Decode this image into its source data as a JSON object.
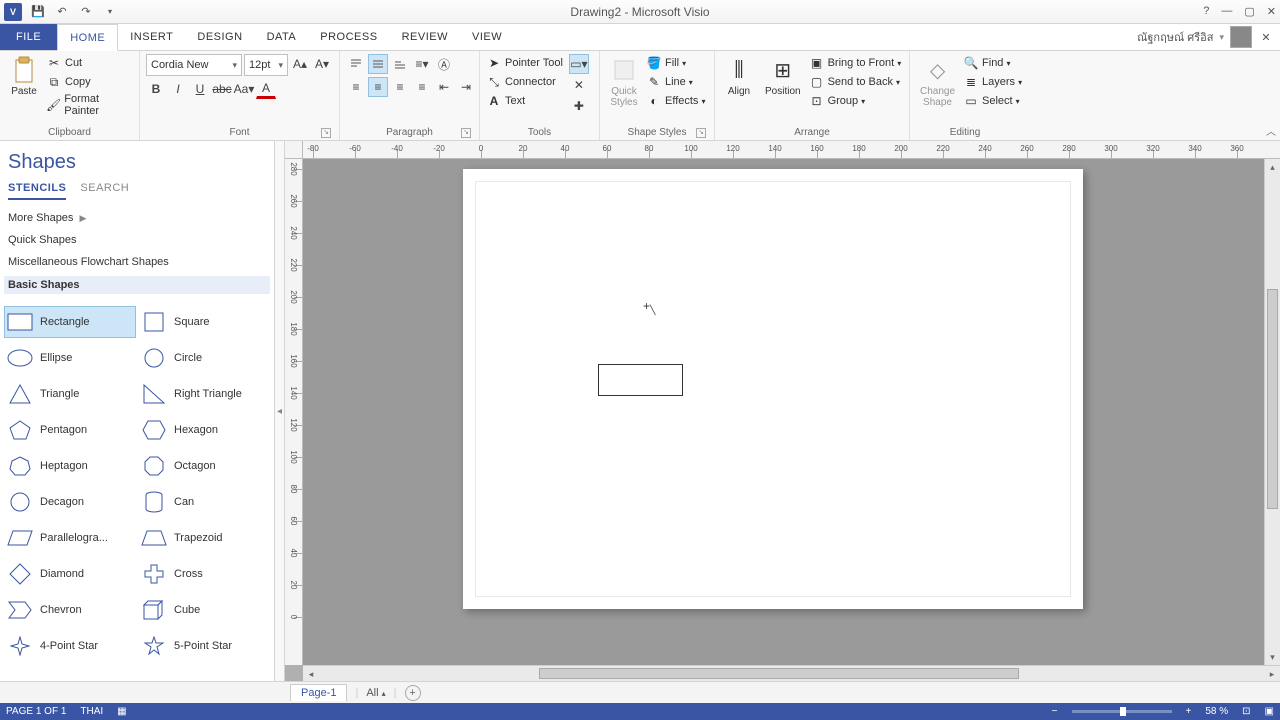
{
  "titlebar": {
    "title": "Drawing2 - Microsoft Visio"
  },
  "tabs": {
    "file": "FILE",
    "home": "HOME",
    "insert": "INSERT",
    "design": "DESIGN",
    "data": "DATA",
    "process": "PROCESS",
    "review": "REVIEW",
    "view": "VIEW",
    "user": "ณัฐกฤษณ์ ศรีอิส"
  },
  "ribbon": {
    "clipboard": {
      "label": "Clipboard",
      "paste": "Paste",
      "cut": "Cut",
      "copy": "Copy",
      "format_painter": "Format Painter"
    },
    "font": {
      "label": "Font",
      "name": "Cordia New",
      "size": "12pt"
    },
    "paragraph": {
      "label": "Paragraph"
    },
    "tools": {
      "label": "Tools",
      "pointer": "Pointer Tool",
      "connector": "Connector",
      "text": "Text"
    },
    "shape_styles": {
      "label": "Shape Styles",
      "quick": "Quick\nStyles",
      "fill": "Fill",
      "line": "Line",
      "effects": "Effects"
    },
    "arrange": {
      "label": "Arrange",
      "align": "Align",
      "position": "Position",
      "bring_front": "Bring to Front",
      "send_back": "Send to Back",
      "group": "Group"
    },
    "editing": {
      "label": "Editing",
      "change": "Change\nShape",
      "find": "Find",
      "layers": "Layers",
      "select": "Select"
    }
  },
  "sidebar": {
    "title": "Shapes",
    "tab_stencils": "STENCILS",
    "tab_search": "SEARCH",
    "stencils": {
      "more": "More Shapes",
      "quick": "Quick Shapes",
      "misc": "Miscellaneous Flowchart Shapes",
      "basic": "Basic Shapes"
    },
    "shapes": [
      {
        "name": "Rectangle"
      },
      {
        "name": "Square"
      },
      {
        "name": "Ellipse"
      },
      {
        "name": "Circle"
      },
      {
        "name": "Triangle"
      },
      {
        "name": "Right Triangle"
      },
      {
        "name": "Pentagon"
      },
      {
        "name": "Hexagon"
      },
      {
        "name": "Heptagon"
      },
      {
        "name": "Octagon"
      },
      {
        "name": "Decagon"
      },
      {
        "name": "Can"
      },
      {
        "name": "Parallelogra..."
      },
      {
        "name": "Trapezoid"
      },
      {
        "name": "Diamond"
      },
      {
        "name": "Cross"
      },
      {
        "name": "Chevron"
      },
      {
        "name": "Cube"
      },
      {
        "name": "4-Point Star"
      },
      {
        "name": "5-Point Star"
      }
    ]
  },
  "pagetabs": {
    "page": "Page-1",
    "all": "All"
  },
  "statusbar": {
    "page": "PAGE 1 OF 1",
    "lang": "THAI",
    "zoom": "58 %"
  },
  "ruler": {
    "h": [
      "-80",
      "-60",
      "-40",
      "-20",
      "0",
      "20",
      "40",
      "60",
      "80",
      "100",
      "120",
      "140",
      "160",
      "180",
      "200",
      "220",
      "240",
      "260",
      "280",
      "300",
      "320",
      "340",
      "360"
    ],
    "v": [
      "280",
      "260",
      "240",
      "220",
      "200",
      "180",
      "160",
      "140",
      "120",
      "100",
      "80",
      "60",
      "40",
      "20",
      "0"
    ]
  }
}
